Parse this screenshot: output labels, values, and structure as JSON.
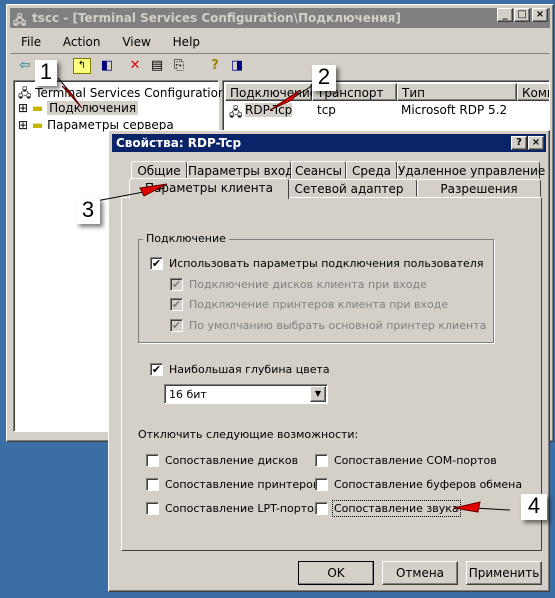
{
  "main_window": {
    "title": "tscc - [Terminal Services Configuration\\Подключения]",
    "title_icon": "network-computer-icon",
    "menu": [
      "File",
      "Action",
      "View",
      "Help"
    ],
    "toolbar": [
      "back-arrow-icon",
      "forward-arrow-icon",
      "up-folder-icon",
      "show-tree-icon",
      "delete-icon",
      "properties-icon",
      "export-list-icon",
      "help-icon",
      "show-action-pane-icon"
    ],
    "tree": {
      "root": "Terminal Services Configuration",
      "items": [
        "Подключения",
        "Параметры сервера"
      ]
    },
    "list": {
      "columns": [
        "Подключение",
        "Транспорт",
        "Тип",
        "Комм"
      ],
      "rows": [
        {
          "name": "RDP-Tcp",
          "transport": "tcp",
          "type": "Microsoft RDP 5.2"
        }
      ]
    }
  },
  "dialog": {
    "title": "Свойства: RDP-Tcp",
    "tabs_row1": [
      "Общие",
      "Параметры входа",
      "Сеансы",
      "Среда",
      "Удаленное управление"
    ],
    "tabs_row2": [
      "Параметры клиента",
      "Сетевой адаптер",
      "Разрешения"
    ],
    "active_tab": "Параметры клиента",
    "group_title": "Подключение",
    "use_user_settings": {
      "label": "Использовать параметры подключения пользователя",
      "checked": true
    },
    "sub_options": [
      {
        "label": "Подключение дисков клиента при входе",
        "checked": true,
        "disabled": true
      },
      {
        "label": "Подключение принтеров клиента при входе",
        "checked": true,
        "disabled": true
      },
      {
        "label": "По умолчанию выбрать основной принтер клиента",
        "checked": true,
        "disabled": true
      }
    ],
    "color_depth": {
      "label": "Наибольшая глубина цвета",
      "checked": true,
      "value": "16 бит"
    },
    "disable_title": "Отключить следующие возможности:",
    "disable_options": [
      {
        "label": "Сопоставление дисков",
        "checked": false
      },
      {
        "label": "Сопоставление COM-портов",
        "checked": false
      },
      {
        "label": "Сопоставление принтеров",
        "checked": false
      },
      {
        "label": "Сопоставление буферов обмена",
        "checked": false
      },
      {
        "label": "Сопоставление LPT-портов",
        "checked": false
      },
      {
        "label": "Сопоставление звука",
        "checked": false
      }
    ],
    "buttons": {
      "ok": "OK",
      "cancel": "Отмена",
      "apply": "Применить"
    }
  },
  "callouts": [
    "1",
    "2",
    "3",
    "4"
  ],
  "colors": {
    "desktop": "#3a6ea5",
    "dialog_title": "#0a246a",
    "arrow": "#e00000"
  }
}
